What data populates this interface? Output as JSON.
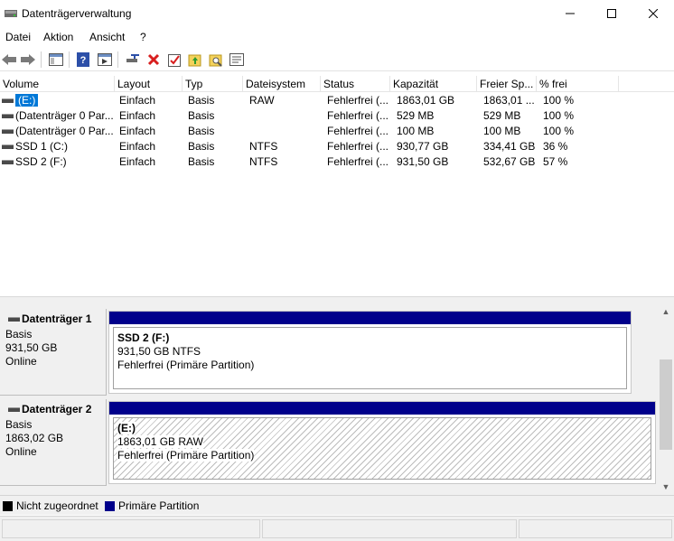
{
  "window": {
    "title": "Datenträgerverwaltung",
    "minimize_icon": "minimize-icon",
    "maximize_icon": "maximize-icon",
    "close_icon": "close-icon"
  },
  "menu": {
    "items": [
      {
        "label": "Datei"
      },
      {
        "label": "Aktion"
      },
      {
        "label": "Ansicht"
      },
      {
        "label": "?"
      }
    ]
  },
  "toolbar": {
    "buttons": [
      "back-icon",
      "forward-icon",
      "show-hide-console-tree-icon",
      "help-icon",
      "properties-icon",
      "connect-disk-icon",
      "delete-icon",
      "check-icon",
      "folder-up-icon",
      "search-folder-icon",
      "properties-sheet-icon"
    ]
  },
  "volume_table": {
    "columns": [
      "Volume",
      "Layout",
      "Typ",
      "Dateisystem",
      "Status",
      "Kapazität",
      "Freier Sp...",
      "% frei"
    ],
    "rows": [
      {
        "volume": "(E:)",
        "layout": "Einfach",
        "typ": "Basis",
        "fs": "RAW",
        "status": "Fehlerfrei (...",
        "capacity": "1863,01 GB",
        "free": "1863,01 ...",
        "pct": "100 %",
        "selected": true
      },
      {
        "volume": "(Datenträger 0 Par...",
        "layout": "Einfach",
        "typ": "Basis",
        "fs": "",
        "status": "Fehlerfrei (...",
        "capacity": "529 MB",
        "free": "529 MB",
        "pct": "100 %",
        "selected": false
      },
      {
        "volume": "(Datenträger 0 Par...",
        "layout": "Einfach",
        "typ": "Basis",
        "fs": "",
        "status": "Fehlerfrei (...",
        "capacity": "100 MB",
        "free": "100 MB",
        "pct": "100 %",
        "selected": false
      },
      {
        "volume": "SSD 1 (C:)",
        "layout": "Einfach",
        "typ": "Basis",
        "fs": "NTFS",
        "status": "Fehlerfrei (...",
        "capacity": "930,77 GB",
        "free": "334,41 GB",
        "pct": "36 %",
        "selected": false
      },
      {
        "volume": "SSD 2 (F:)",
        "layout": "Einfach",
        "typ": "Basis",
        "fs": "NTFS",
        "status": "Fehlerfrei (...",
        "capacity": "931,50 GB",
        "free": "532,67 GB",
        "pct": "57 %",
        "selected": false
      }
    ]
  },
  "disks": [
    {
      "name": "Datenträger 1",
      "type": "Basis",
      "size": "931,50 GB",
      "state": "Online",
      "partition": {
        "name": "SSD 2  (F:)",
        "size": "931,50 GB NTFS",
        "status": "Fehlerfrei (Primäre Partition)",
        "hatched": false
      }
    },
    {
      "name": "Datenträger 2",
      "type": "Basis",
      "size": "1863,02 GB",
      "state": "Online",
      "partition": {
        "name": "(E:)",
        "size": "1863,01 GB RAW",
        "status": "Fehlerfrei (Primäre Partition)",
        "hatched": true
      }
    }
  ],
  "legend": {
    "items": [
      {
        "label": "Nicht zugeordnet",
        "color": "#000000"
      },
      {
        "label": "Primäre Partition",
        "color": "#00008b"
      }
    ]
  },
  "colors": {
    "selection": "#0078d7",
    "primary_partition": "#00008b",
    "unallocated": "#000000"
  }
}
